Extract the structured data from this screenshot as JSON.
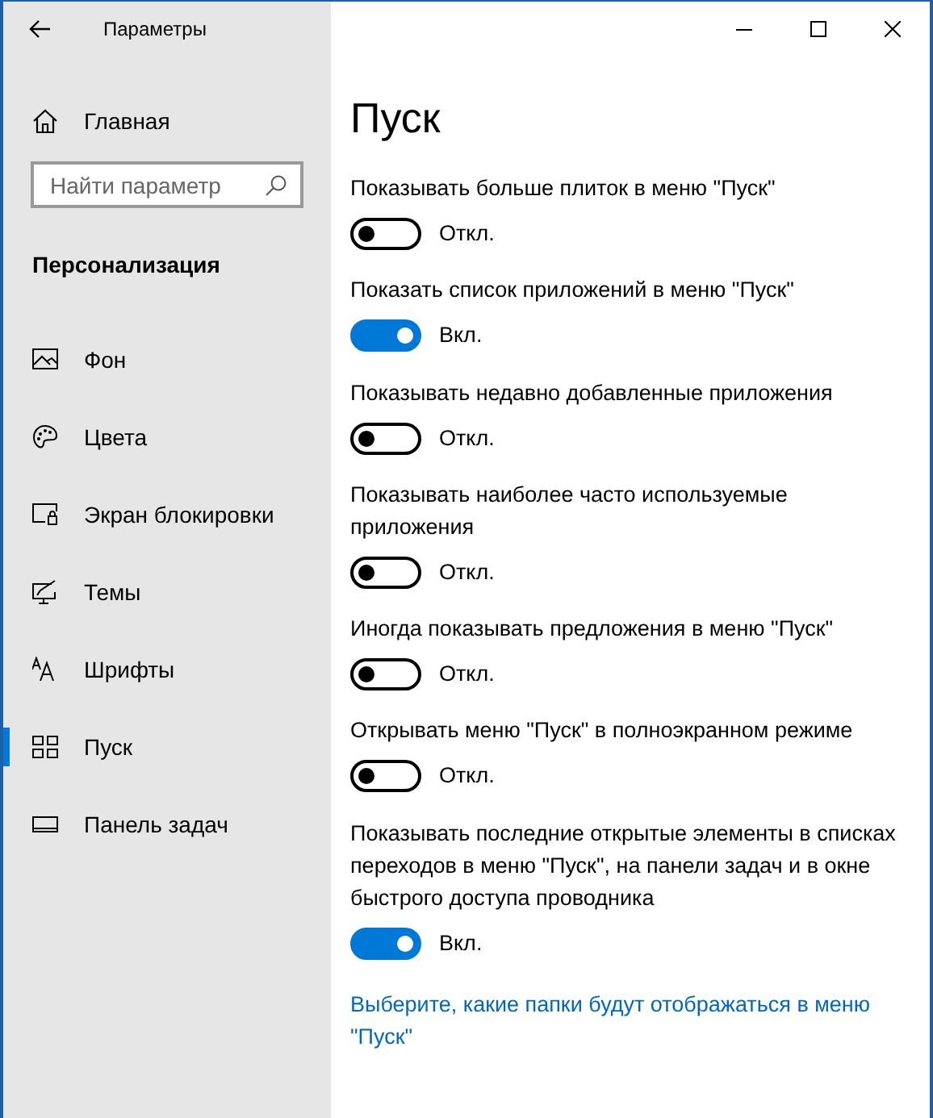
{
  "window": {
    "title": "Параметры"
  },
  "sidebar": {
    "home": "Главная",
    "search": {
      "placeholder": "Найти параметр"
    },
    "section": "Персонализация",
    "items": [
      {
        "label": "Фон",
        "selected": false
      },
      {
        "label": "Цвета",
        "selected": false
      },
      {
        "label": "Экран блокировки",
        "selected": false
      },
      {
        "label": "Темы",
        "selected": false
      },
      {
        "label": "Шрифты",
        "selected": false
      },
      {
        "label": "Пуск",
        "selected": true
      },
      {
        "label": "Панель задач",
        "selected": false
      }
    ]
  },
  "page": {
    "title": "Пуск",
    "settings": [
      {
        "label": "Показывать больше плиток в меню \"Пуск\"",
        "on": false,
        "state": "Откл."
      },
      {
        "label": "Показать список приложений в меню \"Пуск\"",
        "on": true,
        "state": "Вкл."
      },
      {
        "label": "Показывать недавно добавленные приложения",
        "on": false,
        "state": "Откл."
      },
      {
        "label": "Показывать наиболее часто используемые приложения",
        "on": false,
        "state": "Откл."
      },
      {
        "label": "Иногда показывать предложения в меню \"Пуск\"",
        "on": false,
        "state": "Откл."
      },
      {
        "label": "Открывать меню \"Пуск\" в полноэкранном режиме",
        "on": false,
        "state": "Откл."
      },
      {
        "label": "Показывать последние открытые элементы в списках переходов в меню \"Пуск\", на панели задач и в окне быстрого доступа проводника",
        "on": true,
        "state": "Вкл."
      }
    ],
    "link": "Выберите, какие папки будут отображаться в меню \"Пуск\""
  }
}
